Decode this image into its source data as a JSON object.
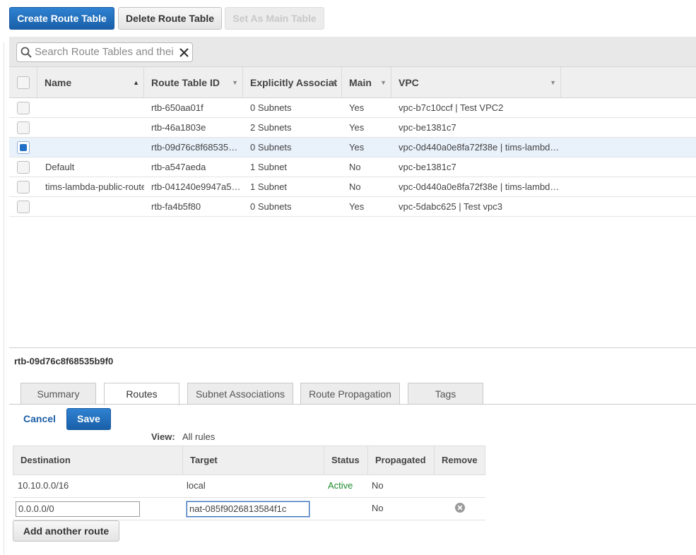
{
  "toolbar": {
    "create_label": "Create Route Table",
    "delete_label": "Delete Route Table",
    "set_main_label": "Set As Main Table"
  },
  "search": {
    "placeholder": "Search Route Tables and thei"
  },
  "table": {
    "columns": [
      "Name",
      "Route Table ID",
      "Explicitly Associat",
      "Main",
      "VPC"
    ],
    "rows": [
      {
        "name": "",
        "id": "rtb-650aa01f",
        "assoc": "0 Subnets",
        "main": "Yes",
        "vpc": "vpc-b7c10ccf | Test VPC2",
        "selected": false
      },
      {
        "name": "",
        "id": "rtb-46a1803e",
        "assoc": "2 Subnets",
        "main": "Yes",
        "vpc": "vpc-be1381c7",
        "selected": false
      },
      {
        "name": "",
        "id": "rtb-09d76c8f68535…",
        "assoc": "0 Subnets",
        "main": "Yes",
        "vpc": "vpc-0d440a0e8fa72f38e | tims-lambd…",
        "selected": true
      },
      {
        "name": "Default",
        "id": "rtb-a547aeda",
        "assoc": "1 Subnet",
        "main": "No",
        "vpc": "vpc-be1381c7",
        "selected": false
      },
      {
        "name": "tims-lambda-public-route",
        "id": "rtb-041240e9947a5…",
        "assoc": "1 Subnet",
        "main": "No",
        "vpc": "vpc-0d440a0e8fa72f38e | tims-lambd…",
        "selected": false
      },
      {
        "name": "",
        "id": "rtb-fa4b5f80",
        "assoc": "0 Subnets",
        "main": "Yes",
        "vpc": "vpc-5dabc625 | Test vpc3",
        "selected": false
      }
    ]
  },
  "detail": {
    "title": "rtb-09d76c8f68535b9f0",
    "tabs": [
      "Summary",
      "Routes",
      "Subnet Associations",
      "Route Propagation",
      "Tags"
    ],
    "active_tab": "Routes",
    "cancel_label": "Cancel",
    "save_label": "Save",
    "view_label": "View:",
    "view_value": "All rules",
    "routes_columns": [
      "Destination",
      "Target",
      "Status",
      "Propagated",
      "Remove"
    ],
    "routes": [
      {
        "destination": "10.10.0.0/16",
        "target": "local",
        "status": "Active",
        "propagated": "No"
      },
      {
        "destination": "0.0.0.0/0",
        "target": "nat-085f9026813584f1c",
        "status": "",
        "propagated": "No"
      }
    ],
    "add_route_label": "Add another route"
  },
  "colors": {
    "primary": "#1f6fc4",
    "active_status": "#1d8a2e",
    "link": "#1c5fa5"
  }
}
